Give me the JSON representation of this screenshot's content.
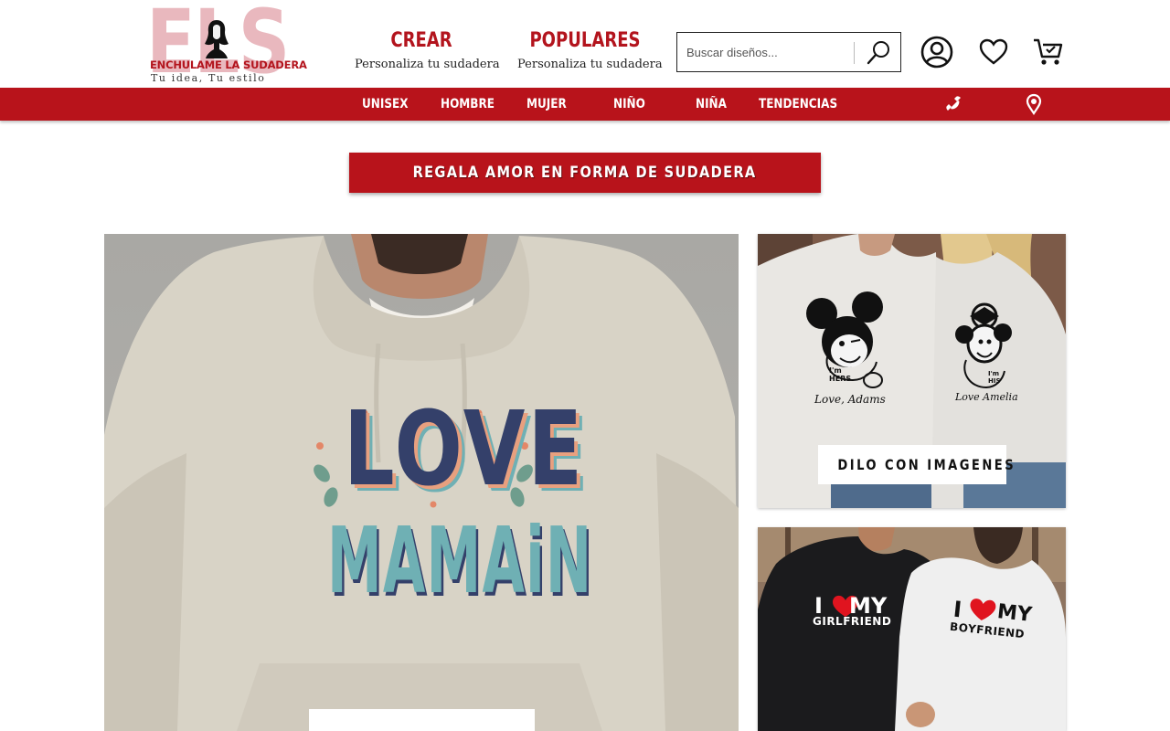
{
  "brand": {
    "short": "ELS",
    "name": "ENCHULAME LA SUDADERA",
    "tagline": "Tu idea, Tu estilo"
  },
  "header": {
    "crear": {
      "title": "CREAR",
      "subtitle": "Personaliza tu sudadera"
    },
    "populares": {
      "title": "POPULARES",
      "subtitle": "Personaliza tu sudadera"
    },
    "search": {
      "placeholder": "Buscar diseños..."
    },
    "icons": [
      "user-icon",
      "heart-icon",
      "cart-icon",
      "search-icon"
    ]
  },
  "menu": {
    "items": [
      "UNISEX",
      "HOMBRE",
      "MUJER",
      "NIÑO",
      "NIÑA",
      "TENDENCIAS"
    ],
    "icons": [
      "phone-icon",
      "location-pin-icon"
    ]
  },
  "banner": {
    "text": "REGALA AMOR EN FORMA DE  SUDADERA"
  },
  "hero": {
    "print": {
      "line1": "LOVE",
      "line2": "MAMAiN"
    }
  },
  "cards": [
    {
      "label": "DILO CON IMAGENES",
      "print_left": {
        "caption": "I'm HERS",
        "signature": "Love, Adams"
      },
      "print_right": {
        "caption": "I'm HIS",
        "signature": "Love Amelia"
      }
    },
    {
      "print_left": {
        "line1": "I",
        "line2": "MY",
        "line3": "GIRLFRIEND"
      },
      "print_right": {
        "line1": "I",
        "line2": "MY",
        "line3": "BOYFRIEND"
      }
    }
  ],
  "colors": {
    "brand_red": "#b8131b",
    "logo_pink": "#e9b8be",
    "white": "#ffffff"
  }
}
